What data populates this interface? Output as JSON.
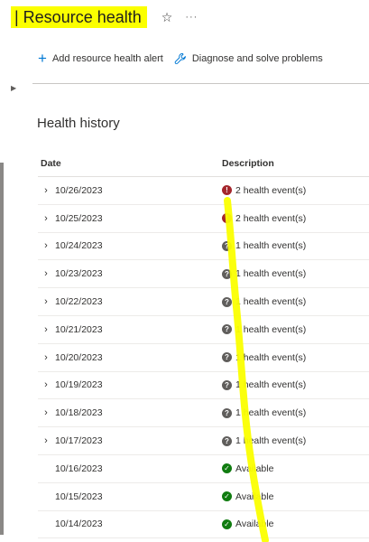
{
  "header": {
    "title": "| Resource health",
    "star_icon": "star-outline-icon",
    "more_label": "···"
  },
  "toolbar": {
    "add_alert_label": "Add resource health alert",
    "diagnose_label": "Diagnose and solve problems"
  },
  "section": {
    "title": "Health history"
  },
  "table": {
    "columns": [
      "Date",
      "Description"
    ],
    "rows": [
      {
        "date": "10/26/2023",
        "status": "error",
        "description": "2 health event(s)",
        "expandable": true
      },
      {
        "date": "10/25/2023",
        "status": "error",
        "description": "2 health event(s)",
        "expandable": true
      },
      {
        "date": "10/24/2023",
        "status": "unknown",
        "description": "1 health event(s)",
        "expandable": true
      },
      {
        "date": "10/23/2023",
        "status": "unknown",
        "description": "1 health event(s)",
        "expandable": true
      },
      {
        "date": "10/22/2023",
        "status": "unknown",
        "description": "1 health event(s)",
        "expandable": true
      },
      {
        "date": "10/21/2023",
        "status": "unknown",
        "description": "1 health event(s)",
        "expandable": true
      },
      {
        "date": "10/20/2023",
        "status": "unknown",
        "description": "1 health event(s)",
        "expandable": true
      },
      {
        "date": "10/19/2023",
        "status": "unknown",
        "description": "1 health event(s)",
        "expandable": true
      },
      {
        "date": "10/18/2023",
        "status": "unknown",
        "description": "1 health event(s)",
        "expandable": true
      },
      {
        "date": "10/17/2023",
        "status": "unknown",
        "description": "1 health event(s)",
        "expandable": true
      },
      {
        "date": "10/16/2023",
        "status": "ok",
        "description": "Available",
        "expandable": false
      },
      {
        "date": "10/15/2023",
        "status": "ok",
        "description": "Available",
        "expandable": false
      },
      {
        "date": "10/14/2023",
        "status": "ok",
        "description": "Available",
        "expandable": false
      }
    ]
  },
  "colors": {
    "highlight": "#fbff00",
    "accent": "#0078d4",
    "error": "#a4262c",
    "unknown": "#605e5c",
    "ok": "#107c10"
  }
}
